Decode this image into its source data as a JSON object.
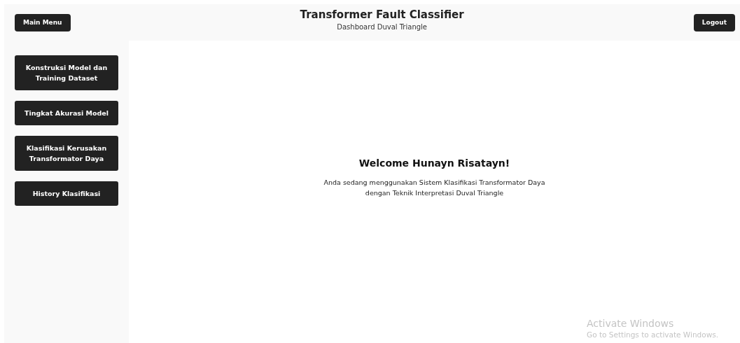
{
  "header": {
    "menu_button": "Main Menu",
    "title": "Transformer Fault Classifier",
    "subtitle": "Dashboard Duval Triangle",
    "logout_button": "Logout"
  },
  "sidebar": {
    "items": [
      {
        "label": "Konstruksi Model dan Training Dataset"
      },
      {
        "label": "Tingkat Akurasi Model"
      },
      {
        "label": "Klasifikasi Kerusakan Transformator Daya"
      },
      {
        "label": "History Klasifikasi"
      }
    ]
  },
  "main": {
    "heading": "Welcome Hunayn Risatayn!",
    "description_lines": [
      "Anda sedang menggunakan Sistem Klasifikasi Transformator Daya",
      "dengan Teknik Interpretasi Duval Triangle"
    ]
  },
  "os_overlay": {
    "title": "Activate Windows",
    "subtitle": "Go to Settings to activate Windows."
  }
}
